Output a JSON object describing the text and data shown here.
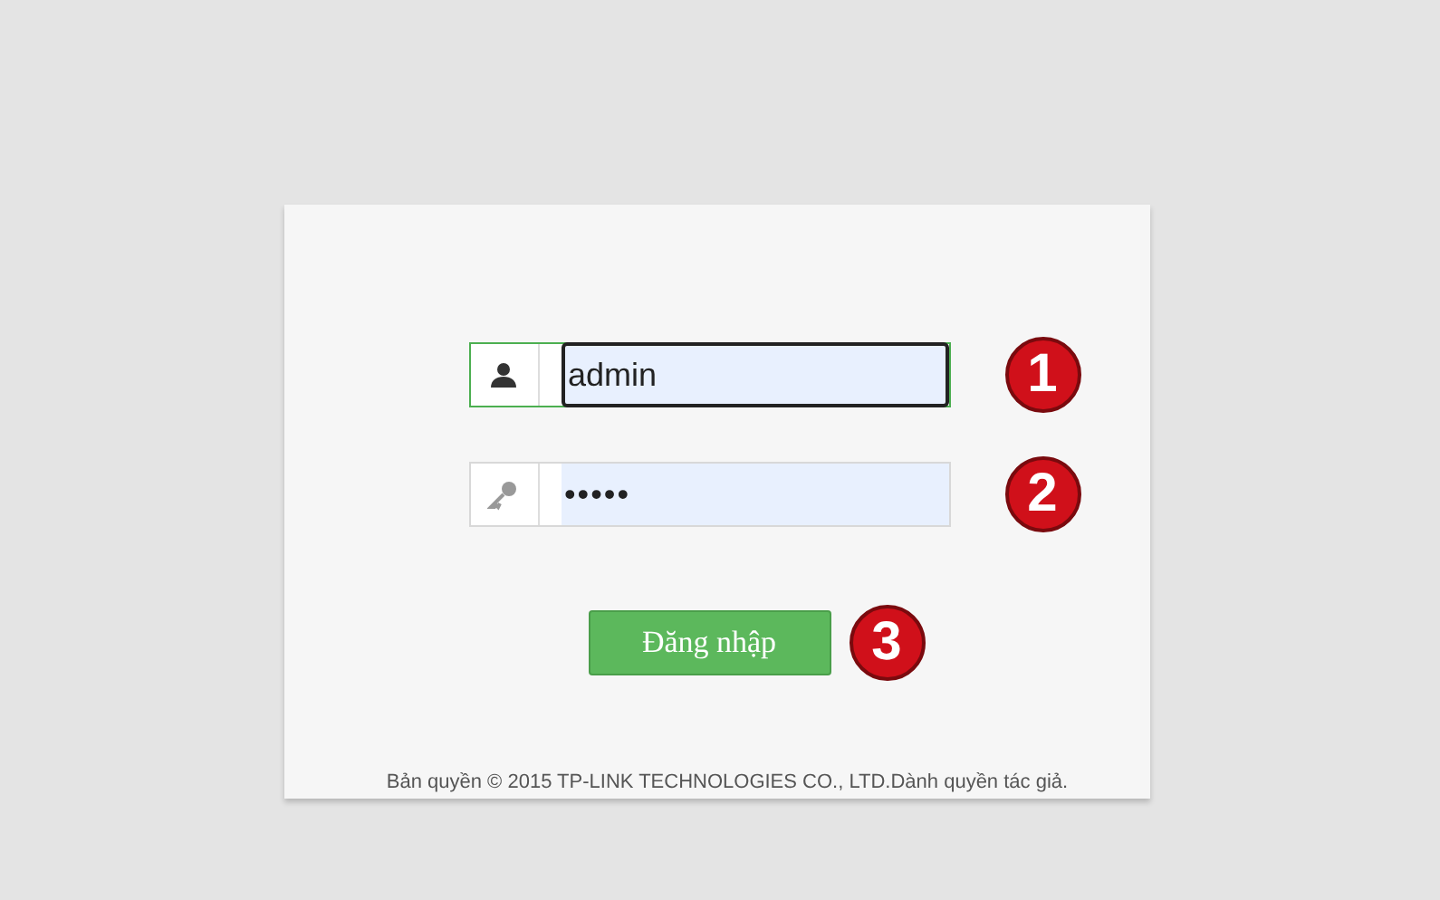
{
  "login_form": {
    "fields": [
      {
        "kind": "username",
        "value": "admin",
        "focused": true,
        "step": "1"
      },
      {
        "kind": "password",
        "value": "•••••",
        "focused": false,
        "step": "2"
      }
    ],
    "submit": {
      "label": "Đăng nhập",
      "step": "3"
    },
    "footer": "Bản quyền © 2015 TP-LINK TECHNOLOGIES CO., LTD.Dành quyền tác giả."
  }
}
